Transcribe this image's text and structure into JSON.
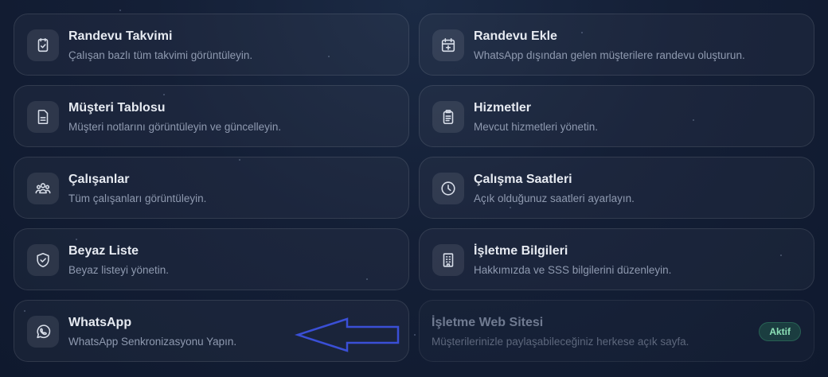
{
  "cards": [
    {
      "title": "Randevu Takvimi",
      "description": "Çalışan bazlı tüm takvimi görüntüleyin.",
      "icon": "calendar-check-icon"
    },
    {
      "title": "Randevu Ekle",
      "description": "WhatsApp dışından gelen müşterilere randevu oluşturun.",
      "icon": "calendar-add-icon"
    },
    {
      "title": "Müşteri Tablosu",
      "description": "Müşteri notlarını görüntüleyin ve güncelleyin.",
      "icon": "document-icon"
    },
    {
      "title": "Hizmetler",
      "description": "Mevcut hizmetleri yönetin.",
      "icon": "clipboard-list-icon"
    },
    {
      "title": "Çalışanlar",
      "description": "Tüm çalışanları görüntüleyin.",
      "icon": "users-icon"
    },
    {
      "title": "Çalışma Saatleri",
      "description": "Açık olduğunuz saatleri ayarlayın.",
      "icon": "clock-icon"
    },
    {
      "title": "Beyaz Liste",
      "description": "Beyaz listeyi yönetin.",
      "icon": "shield-check-icon"
    },
    {
      "title": "İşletme Bilgileri",
      "description": "Hakkımızda ve SSS bilgilerini düzenleyin.",
      "icon": "building-icon"
    },
    {
      "title": "WhatsApp",
      "description": "WhatsApp Senkronizasyonu Yapın.",
      "icon": "whatsapp-icon"
    },
    {
      "title": "İşletme Web Sitesi",
      "description": "Müşterilerinizle paylaşabileceğiniz herkese açık sayfa.",
      "badge": "Aktif"
    }
  ],
  "colors": {
    "background": "#141f36",
    "annotation_arrow": "#3a4fd6",
    "badge_text": "#8ce0b6"
  }
}
